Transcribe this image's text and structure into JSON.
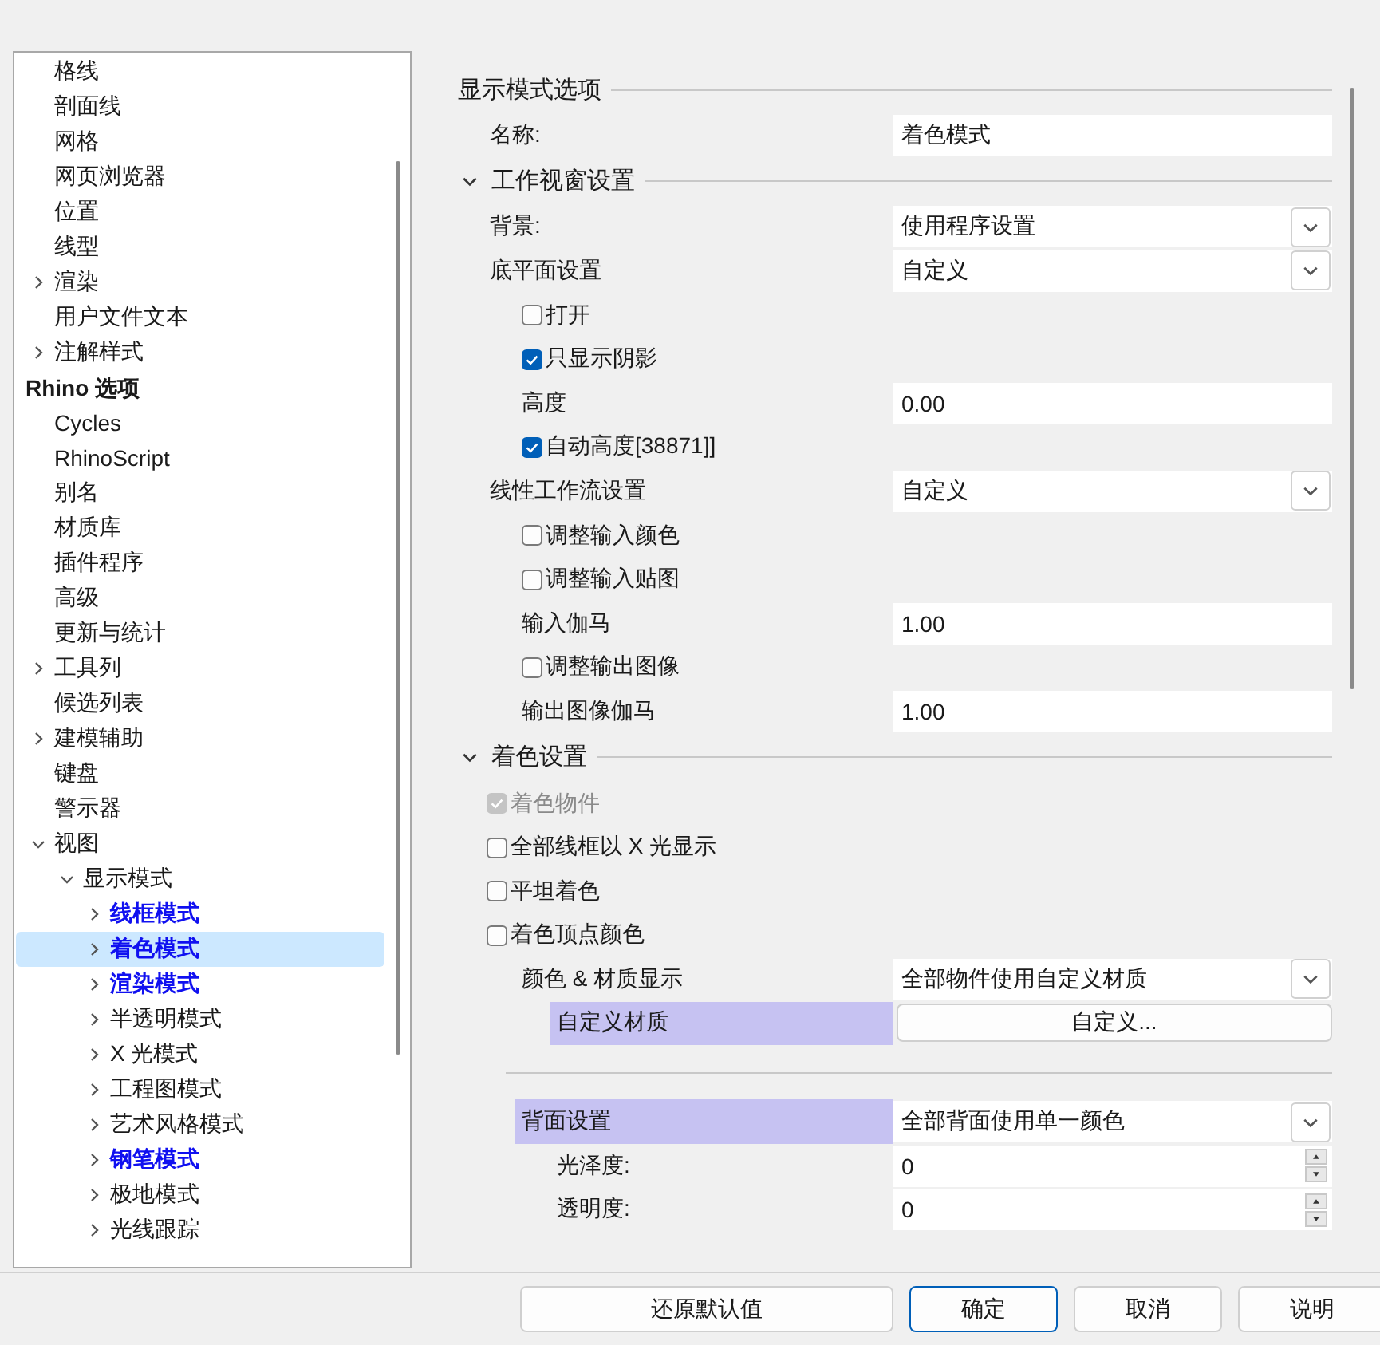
{
  "tree": {
    "groups": [
      {
        "items": [
          {
            "label": "格线",
            "selected": false
          },
          {
            "label": "剖面线",
            "selected": false
          },
          {
            "label": "网格",
            "selected": false
          },
          {
            "label": "网页浏览器",
            "selected": false
          },
          {
            "label": "位置",
            "selected": false
          },
          {
            "label": "线型",
            "selected": false
          },
          {
            "label": "渲染",
            "selected": false,
            "expanded": false
          },
          {
            "label": "用户文件文本",
            "selected": false
          },
          {
            "label": "注解样式",
            "selected": false,
            "expanded": false
          }
        ]
      },
      {
        "heading": "Rhino 选项",
        "items": [
          {
            "label": "Cycles",
            "selected": false
          },
          {
            "label": "RhinoScript",
            "selected": false
          },
          {
            "label": "别名",
            "selected": false
          },
          {
            "label": "材质库",
            "selected": false
          },
          {
            "label": "插件程序",
            "selected": false
          },
          {
            "label": "高级",
            "selected": false
          },
          {
            "label": "更新与统计",
            "selected": false
          },
          {
            "label": "工具列",
            "selected": false,
            "expanded": false
          },
          {
            "label": "候选列表",
            "selected": false
          },
          {
            "label": "建模辅助",
            "selected": false,
            "expanded": false
          },
          {
            "label": "键盘",
            "selected": false
          },
          {
            "label": "警示器",
            "selected": false
          },
          {
            "label": "视图",
            "selected": false,
            "expanded": true,
            "children": [
              {
                "label": "显示模式",
                "selected": false,
                "expanded": true,
                "children": [
                  {
                    "label": "线框模式",
                    "selected": false,
                    "expanded": false,
                    "modified": true
                  },
                  {
                    "label": "着色模式",
                    "selected": true,
                    "expanded": false,
                    "modified": true
                  },
                  {
                    "label": "渲染模式",
                    "selected": false,
                    "expanded": false,
                    "modified": true
                  },
                  {
                    "label": "半透明模式",
                    "selected": false,
                    "expanded": false,
                    "modified": false
                  },
                  {
                    "label": "X 光模式",
                    "selected": false,
                    "expanded": false,
                    "modified": false
                  },
                  {
                    "label": "工程图模式",
                    "selected": false,
                    "expanded": false,
                    "modified": false
                  },
                  {
                    "label": "艺术风格模式",
                    "selected": false,
                    "expanded": false,
                    "modified": false
                  },
                  {
                    "label": "钢笔模式",
                    "selected": false,
                    "expanded": false,
                    "modified": true
                  },
                  {
                    "label": "极地模式",
                    "selected": false,
                    "expanded": false,
                    "modified": false
                  },
                  {
                    "label": "光线跟踪",
                    "selected": false,
                    "expanded": false,
                    "modified": false
                  }
                ]
              }
            ]
          }
        ]
      }
    ]
  },
  "settings": {
    "sections": [
      {
        "title": "显示模式选项",
        "rows": [
          {
            "kind": "text",
            "label": "名称:",
            "value": "着色模式"
          }
        ]
      },
      {
        "title": "工作视窗设置",
        "expanded": true,
        "rows": [
          {
            "kind": "dropdown",
            "label": "背景:",
            "value": "使用程序设置"
          },
          {
            "kind": "dropdown",
            "label": "底平面设置",
            "value": "自定义",
            "children": [
              {
                "kind": "checkbox",
                "label": "打开",
                "checked": false
              },
              {
                "kind": "checkbox",
                "label": "只显示阴影",
                "checked": true
              },
              {
                "kind": "text",
                "label": "高度",
                "value": "0.00"
              },
              {
                "kind": "checkbox",
                "label": "自动高度[38871]]",
                "checked": true
              }
            ]
          },
          {
            "kind": "dropdown",
            "label": "线性工作流设置",
            "value": "自定义",
            "children": [
              {
                "kind": "checkbox",
                "label": "调整输入颜色",
                "checked": false
              },
              {
                "kind": "checkbox",
                "label": "调整输入贴图",
                "checked": false
              },
              {
                "kind": "text",
                "label": "输入伽马",
                "value": "1.00"
              },
              {
                "kind": "checkbox",
                "label": "调整输出图像",
                "checked": false
              },
              {
                "kind": "text",
                "label": "输出图像伽马",
                "value": "1.00"
              }
            ]
          }
        ]
      },
      {
        "title": "着色设置",
        "expanded": true,
        "rows": [
          {
            "kind": "checkbox",
            "label": "着色物件",
            "checked": true,
            "disabled": true
          },
          {
            "kind": "checkbox",
            "label": "全部线框以 X 光显示",
            "checked": false,
            "disabled": false
          },
          {
            "kind": "checkbox",
            "label": "平坦着色",
            "checked": false,
            "disabled": false
          },
          {
            "kind": "checkbox",
            "label": "着色顶点颜色",
            "checked": false,
            "disabled": false,
            "children": [
              {
                "kind": "dropdown",
                "label": "颜色 & 材质显示",
                "value": "全部物件使用自定义材质",
                "highlighted": false,
                "children": [
                  {
                    "kind": "button",
                    "label": "自定义材质",
                    "value": "自定义...",
                    "highlighted": true
                  }
                ]
              },
              {
                "kind": "separator"
              },
              {
                "kind": "dropdown",
                "label": "背面设置",
                "value": "全部背面使用单一颜色",
                "highlighted": true,
                "children": [
                  {
                    "kind": "spinner",
                    "label": "光泽度:",
                    "value": "0"
                  },
                  {
                    "kind": "spinner",
                    "label": "透明度:",
                    "value": "0"
                  }
                ]
              }
            ]
          }
        ]
      }
    ]
  },
  "buttons": [
    {
      "label": "还原默认值",
      "kind": "wide"
    },
    {
      "label": "确定",
      "kind": "default"
    },
    {
      "label": "取消",
      "kind": "normal"
    },
    {
      "label": "说明",
      "kind": "normal"
    }
  ]
}
